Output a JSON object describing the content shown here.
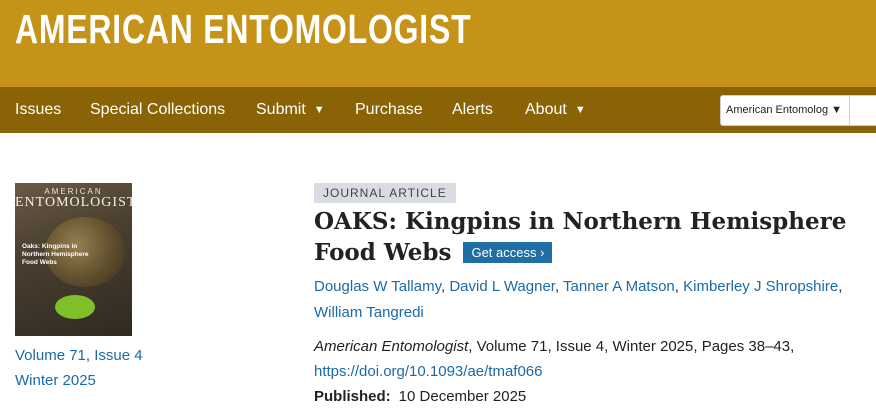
{
  "header": {
    "site_title": "AMERICAN ENTOMOLOGIST",
    "brand_color": "#c59317",
    "nav_color": "#8a6307"
  },
  "nav": {
    "issues": "Issues",
    "special_collections": "Special Collections",
    "submit": "Submit",
    "purchase": "Purchase",
    "alerts": "Alerts",
    "about": "About",
    "dropdown_caret": "▼"
  },
  "search": {
    "scope_selected": "American Entomologist",
    "scope_arrow": "▼"
  },
  "cover": {
    "journal_small": "AMERICAN",
    "journal_big": "ENTOMOLOGIST",
    "caption": "Oaks: Kingpins in Northern Hemisphere Food Webs"
  },
  "issue": {
    "volume_issue": "Volume 71, Issue 4",
    "season": "Winter 2025"
  },
  "article": {
    "type_badge": "JOURNAL ARTICLE",
    "title": "OAKS: Kingpins in Northern Hemisphere Food Webs",
    "get_access": "Get access",
    "get_access_arrow": "›",
    "authors": [
      "Douglas W Tallamy",
      "David L Wagner",
      "Tanner A Matson",
      "Kimberley J Shropshire",
      "William Tangredi"
    ],
    "author_separator": ", ",
    "citation_journal": "American Entomologist",
    "citation_rest": ", Volume 71, Issue 4, Winter 2025, Pages 38–43,",
    "doi": "https://doi.org/10.1093/ae/tmaf066",
    "published_label": "Published:",
    "published_date": "10 December 2025"
  }
}
